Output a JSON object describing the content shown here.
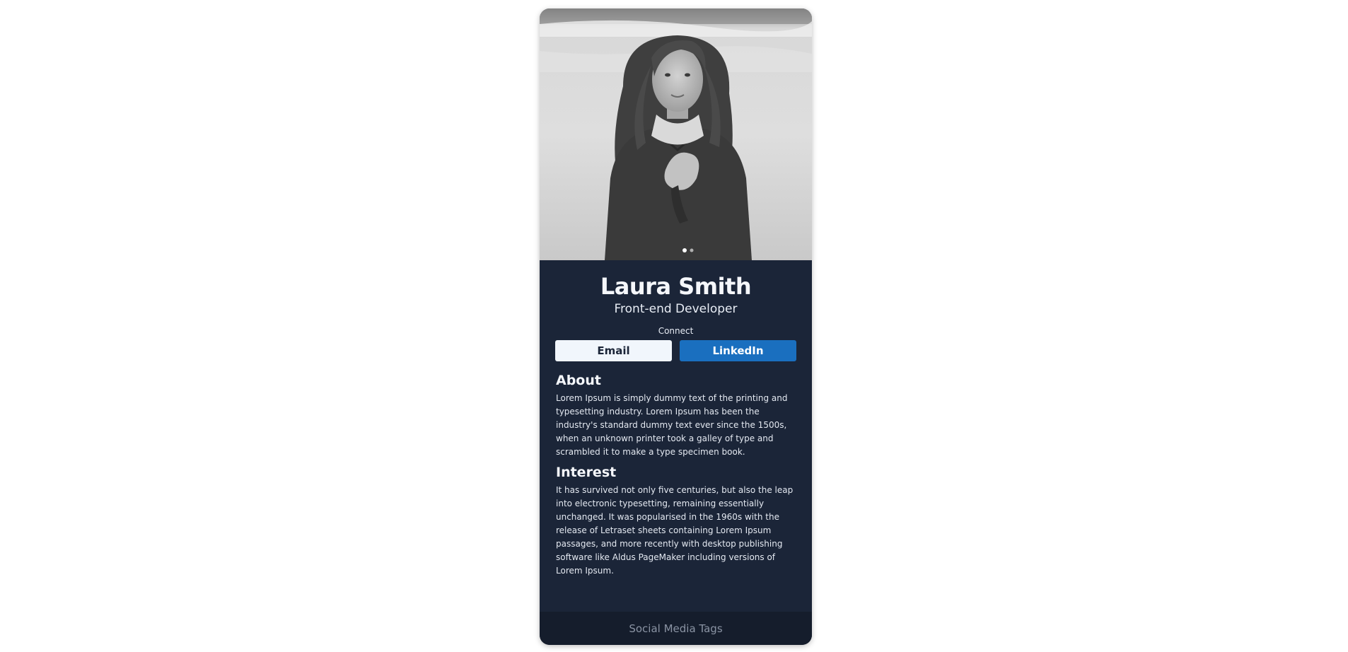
{
  "profile": {
    "photo_alt": "",
    "name": "Laura Smith",
    "role": "Front-end Developer"
  },
  "connect": {
    "label": "Connect",
    "email_label": "Email",
    "linkedin_label": "LinkedIn"
  },
  "about": {
    "title": "About",
    "text": "Lorem Ipsum is simply dummy text of the printing and typesetting industry. Lorem Ipsum has been the industry's standard dummy text ever since the 1500s, when an unknown printer took a galley of type and scrambled it to make a type specimen book."
  },
  "interest": {
    "title": "Interest",
    "text": "It has survived not only five centuries, but also the leap into electronic typesetting, remaining essentially unchanged. It was popularised in the 1960s with the release of Letraset sheets containing Lorem Ipsum passages, and more recently with desktop publishing software like Aldus PageMaker including versions of Lorem Ipsum."
  },
  "footer": {
    "text": "Social Media Tags"
  },
  "colors": {
    "card_bg": "#1b2538",
    "footer_bg": "#151d2c",
    "linkedin_blue": "#1a6fbf",
    "email_bg": "#f1f6fc"
  }
}
